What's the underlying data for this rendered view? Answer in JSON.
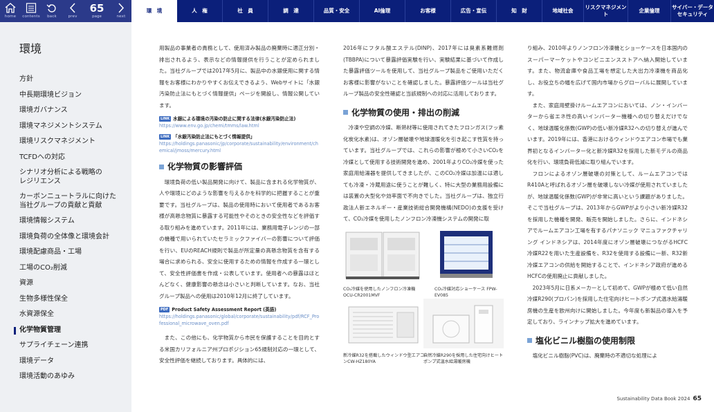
{
  "toolbar": {
    "home_label": "home",
    "contents_label": "contents",
    "back_label": "back",
    "prev_label": "prev",
    "page_label": "page",
    "page_number": "65",
    "next_label": "next"
  },
  "nav_tabs": [
    {
      "label": "環　境"
    },
    {
      "label": "人　権"
    },
    {
      "label": "社　員"
    },
    {
      "label": "調　達"
    },
    {
      "label": "品質・安全"
    },
    {
      "label": "AI倫理"
    },
    {
      "label": "お客様"
    },
    {
      "label": "広告・宣伝"
    },
    {
      "label": "知　財"
    },
    {
      "label": "地域社会"
    },
    {
      "label": "リスクマネジメント"
    },
    {
      "label": "企業倫理"
    },
    {
      "label": "サイバー・データ セキュリティ"
    }
  ],
  "sidebar": {
    "title": "環境",
    "items": [
      {
        "label": "方針"
      },
      {
        "label": "中長期環境ビジョン"
      },
      {
        "label": "環境ガバナンス"
      },
      {
        "label": "環境マネジメントシステム"
      },
      {
        "label": "環境リスクマネジメント"
      },
      {
        "label": "TCFDへの対応"
      },
      {
        "label": "シナリオ分析による戦略の"
      },
      {
        "label": "レジリエンス"
      },
      {
        "label": "カーボンニュートラルに向けた"
      },
      {
        "label": "当社グループの貢献と貢献"
      },
      {
        "label": "環境情報システム"
      },
      {
        "label": "環境負荷の全体像と環境会計"
      },
      {
        "label": "環境配慮商品・工場"
      },
      {
        "label": "工場のCO₂削減"
      },
      {
        "label": "資源"
      },
      {
        "label": "生物多様性保全"
      },
      {
        "label": "水資源保全"
      },
      {
        "label": "化学物質管理"
      },
      {
        "label": "サプライチェーン連携"
      },
      {
        "label": "環境データ"
      },
      {
        "label": "環境活動のあゆみ"
      }
    ]
  },
  "col1": {
    "p1": "用製品の事業者の責務として、使用済み製品の廃棄時に適正分別・排出されるよう、表示などの情報提供を行うことが定められました。当社グループでは2017年5月に、製品中の水銀使用に関する情報をお客様にわかりやすくお伝えできるよう、Webサイトに「水銀汚染防止法にもとづく情報提供」ページを開設し、情報公開しています。",
    "link1_title": "水銀による環境の汚染の防止に関する法律(水銀汚染防止法)",
    "link1_url": "https://www.env.go.jp/chemi/tmms/law.html",
    "link2_title": "「水銀汚染防止法にもとづく情報提供」",
    "link2_url": "https://holdings.panasonic/jp/corporate/sustainability/environment/chemical/jmoss/mercury.html",
    "badge": "LINK",
    "h_assess": "化学物質の影響評価",
    "p2": "環境負荷の低い製品開発に向けて、製品に含まれる化学物質が、人や環境にどのような影響を与えるかを科学的に把握することが重要です。当社グループは、製品の使用時において使用者であるお客様が高懸念物質に暴露する可能性やそのときの安全性などを評価する取り組みを進めています。2011年には、業務用電子レンジの一部の機種で用いられていたセラミックファイバーの影響について評価を行い、EUのREACH規則で製品が所定量の高懸念物質を含有する場合に求められる、安全に使用するための情報を作成する一環として、安全性評価書を作成・公表しています。使用者への暴露はほとんどなく、健康影響の懸念は小さいと判断しています。なお、当社グループ製品への使用は2010年12月に終了しています。",
    "pdf_badge": "PDF",
    "link3_title": "Product Safety Assessment Report (英語)",
    "link3_url": "https://holdings.panasonic/global/corporate/sustainability/pdf/RCF_Professional_microwave_oven.pdf",
    "p3": "また、この他にも、化学物質から市民を保護することを目的とする米国カリフォルニア州プロポジション65規制対応の一環として、安全性評価を継続しております。具体的には、"
  },
  "col2": {
    "p1": "2016年にフタル酸エステル(DINP)、2017年には臭素系難燃剤(TBBPA)について暴露評価実験を行い、実験結果に基づいて作成した暴露評価ツールを使用して、当社グループ製品をご使用いただくお客様に影響がないことを確認しました。暴露評価ツールは当社グループ製品の安全性確認と当該規制への対応に活用しております。",
    "h_use": "化学物質の使用・排出の削減",
    "p2": "冷凍や空調の冷媒、断熱材等に使用されてきたフロンガス(フッ素化炭化水素)は、オゾン層破壊や地球温暖化を引き起こす性質を持っています。当社グループでは、これらの影響が極めて小さいCO₂を冷媒として使用する技術開発を進め、2001年よりCO₂冷媒を使った家庭用給湯器を提供してきましたが、このCO₂冷媒は加温には適しても冷凍・冷蔵用途に使うことが難しく、特に大型の業務用設備には装置の大型化や効率面で不向きでした。当社グループは、独立行政法人新エネルギー・産業技術総合開発機構(NEDO)の支援を受けて、CO₂冷媒を使用したノンフロン冷凍機システムの開発に取",
    "fig1_cap": "CO₂冷媒を使用したノンフロン冷凍機 OCU-CR2001MVF",
    "fig2_cap": "CO₂冷媒対応ショーケース FPW-EV085",
    "fig3_cap": "新冷媒R32を搭載したウィンドウ型エアコンCW-HZ180YA",
    "fig4_cap": "自然冷媒R290を採用した住宅向けヒートポンプ式温水給湯暖房機"
  },
  "col3": {
    "p1": "り組み、2010年よりノンフロン冷凍機とショーケースを日本国内のスーパーマーケットやコンビニエンスストアへ納入開始しています。また、物流倉庫や食品工場を想定した大出力冷凍機を商品化し、お役立ちの幅を広げて国内市場からグローバルに展開しています。",
    "p2": "また、家庭用壁掛けルームエアコンにおいては、ノン・インバーターから省エネ性の高いインバーター機種への切り替えだけでなく、地球温暖化係数(GWP)の低い新冷媒R32への切り替えが進んでいます。2019年には、香港におけるウィンドウエアコン市場でも業界初となるインバーター化と新冷媒R32を採用した新モデルの商品化を行い、環境負荷低減に取り組んでいます。",
    "p3": "フロンによるオゾン層破壊の対策として、ルームエアコンではR410Aと呼ばれるオゾン層を破壊しない冷媒が使用されていましたが、地球温暖化係数(GWP)が非常に高いという課題がありました。そこで当社グループは、2013年からGWPがより小さい新冷媒R32を採用した機種を開発、販売を開始しました。さらに、インドネシアでルームエアコン工場を有するパナソニック マニュファクチャリング インドネシアは、2014年度にオゾン層破壊につながるHCFC冷媒R22を用いた生産設備を、R32を使用する設備に一新、R32新冷媒エアコンの供給を開始することで、インドネシア政府が進めるHCFCの使用廃止に貢献しました。",
    "p4": "2023年5月に日系メーカーとして初めて、GWPが極めて低い自然冷媒R290(プロパン)を採用した住宅向けヒートポンプ式温水給湯暖房機の生産を欧州向けに開始しました。今年度も新製品の導入を予定しており、ラインナップ拡大を進めています。",
    "h_pvc": "塩化ビニル樹脂の使用制限",
    "p5": "塩化ビニル樹脂(PVC)は、廃棄時の不適切な処理によ"
  },
  "footer": {
    "book": "Sustainability Data Book 2024",
    "page": "65"
  }
}
